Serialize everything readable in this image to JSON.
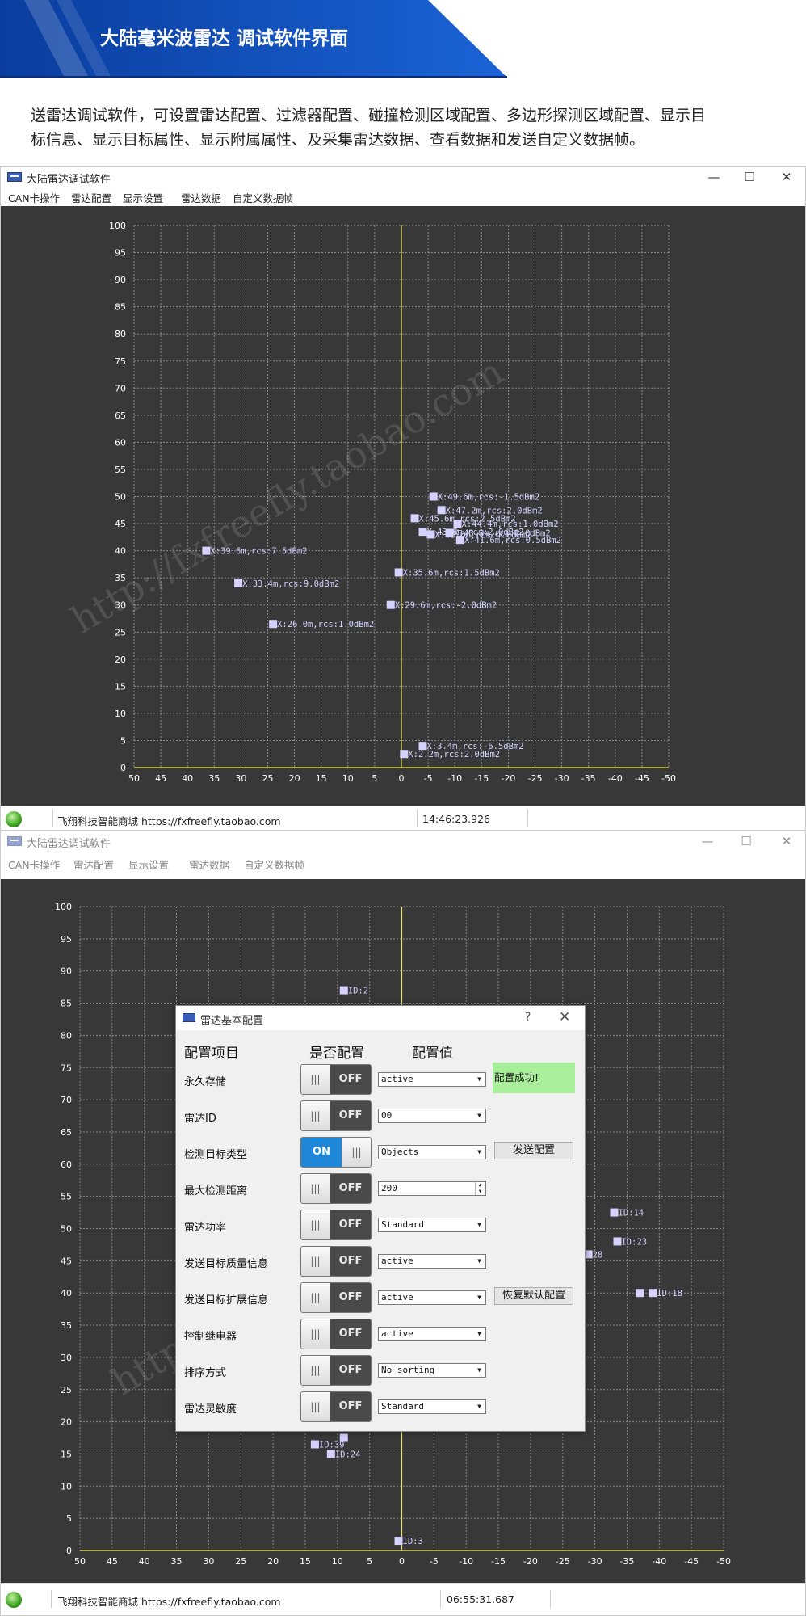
{
  "banner": {
    "title": "大陆毫米波雷达  调试软件界面"
  },
  "description": {
    "line1": "送雷达调试软件，可设置雷达配置、过滤器配置、碰撞检测区域配置、多边形探测区域配置、显示目",
    "line2": "标信息、显示目标属性、显示附属属性、及采集雷达数据、查看数据和发送自定义数据帧。"
  },
  "window": {
    "title": "大陆雷达调试软件",
    "minimize": "—",
    "maximize": "☐",
    "close": "✕",
    "menu": [
      "CAN卡操作",
      "雷达配置",
      "显示设置",
      "雷达数据",
      "自定义数据帧"
    ]
  },
  "plot": {
    "y_ticks": [
      "0",
      "5",
      "10",
      "15",
      "20",
      "25",
      "30",
      "35",
      "40",
      "45",
      "50",
      "55",
      "60",
      "65",
      "70",
      "75",
      "80",
      "85",
      "90",
      "95",
      "100"
    ],
    "x_ticks": [
      "50",
      "45",
      "40",
      "35",
      "30",
      "25",
      "20",
      "15",
      "10",
      "5",
      "0",
      "-5",
      "-10",
      "-15",
      "-20",
      "-25",
      "-30",
      "-35",
      "-40",
      "-45",
      "-50"
    ],
    "watermark": "http://fxfreefly.taobao.com"
  },
  "chart_data": [
    {
      "type": "scatter",
      "x_range": [
        50,
        -50
      ],
      "y_range": [
        0,
        100
      ],
      "grid": true,
      "points": [
        {
          "x": -6,
          "y": 50,
          "label": "X:49.6m,rcs:-1.5dBm2"
        },
        {
          "x": -7.5,
          "y": 47.5,
          "label": "X:47.2m,rcs:2.0dBm2"
        },
        {
          "x": -2.5,
          "y": 46,
          "label": "X:45.6m,rcs:2.5dBm2"
        },
        {
          "x": -10.5,
          "y": 45,
          "label": "X:44.4m,rcs:1.0dBm2"
        },
        {
          "x": -4,
          "y": 43.5,
          "label": "X:43.8m,rcs:2.0dBm2"
        },
        {
          "x": -9,
          "y": 43.3,
          "label": "X:43.3m,rcs:2.0dBm2"
        },
        {
          "x": -5.5,
          "y": 43,
          "label": "X:42.6m,rcs:4.0dBm2"
        },
        {
          "x": -11,
          "y": 42,
          "label": "X:41.6m,rcs:0.5dBm2"
        },
        {
          "x": 36.5,
          "y": 40,
          "label": "X:39.6m,rcs:7.5dBm2"
        },
        {
          "x": 0.5,
          "y": 36,
          "label": "X:35.6m,rcs:1.5dBm2"
        },
        {
          "x": 30.5,
          "y": 34,
          "label": "X:33.4m,rcs:9.0dBm2"
        },
        {
          "x": 2,
          "y": 30,
          "label": "X:29.6m,rcs:-2.0dBm2"
        },
        {
          "x": 24,
          "y": 26.5,
          "label": "X:26.0m,rcs:1.0dBm2"
        },
        {
          "x": -4,
          "y": 4,
          "label": "X:3.4m,rcs:-6.5dBm2"
        },
        {
          "x": -0.5,
          "y": 2.5,
          "label": "X:2.2m,rcs:2.0dBm2"
        }
      ]
    },
    {
      "type": "scatter",
      "x_range": [
        50,
        -50
      ],
      "y_range": [
        0,
        100
      ],
      "grid": true,
      "points": [
        {
          "x": 9,
          "y": 87,
          "label": "ID:2"
        },
        {
          "x": -33,
          "y": 52.5,
          "label": "ID:14"
        },
        {
          "x": -33.5,
          "y": 48,
          "label": "ID:23"
        },
        {
          "x": -29,
          "y": 46,
          "label": "28"
        },
        {
          "x": -37,
          "y": 40,
          "label": ""
        },
        {
          "x": -39,
          "y": 40,
          "label": "ID:18"
        },
        {
          "x": 9,
          "y": 17.5,
          "label": ""
        },
        {
          "x": 13.5,
          "y": 16.5,
          "label": "ID:39"
        },
        {
          "x": 11,
          "y": 15,
          "label": "ID:24"
        },
        {
          "x": 0.5,
          "y": 1.5,
          "label": "ID:3"
        }
      ]
    }
  ],
  "status1": {
    "shop": "飞翔科技智能商城 https://fxfreefly.taobao.com",
    "time": "14:46:23.926"
  },
  "status2": {
    "shop": "飞翔科技智能商城 https://fxfreefly.taobao.com",
    "time": "06:55:31.687"
  },
  "dialog": {
    "title": "雷达基本配置",
    "help": "?",
    "close": "✕",
    "headers": {
      "item": "配置项目",
      "enabled": "是否配置",
      "value": "配置值"
    },
    "toggle_off": "OFF",
    "toggle_on": "ON",
    "knob": "|||",
    "rows": [
      {
        "label": "永久存储",
        "on": false,
        "value": "active"
      },
      {
        "label": "雷达ID",
        "on": false,
        "value": "00"
      },
      {
        "label": "检测目标类型",
        "on": true,
        "value": "Objects"
      },
      {
        "label": "最大检测距离",
        "on": false,
        "value": "200"
      },
      {
        "label": "雷达功率",
        "on": false,
        "value": "Standard"
      },
      {
        "label": "发送目标质量信息",
        "on": false,
        "value": "active"
      },
      {
        "label": "发送目标扩展信息",
        "on": false,
        "value": "active"
      },
      {
        "label": "控制继电器",
        "on": false,
        "value": "active"
      },
      {
        "label": "排序方式",
        "on": false,
        "value": "No sorting"
      },
      {
        "label": "雷达灵敏度",
        "on": false,
        "value": "Standard"
      }
    ],
    "success": "配置成功!",
    "send_button": "发送配置",
    "restore_button": "恢复默认配置"
  }
}
